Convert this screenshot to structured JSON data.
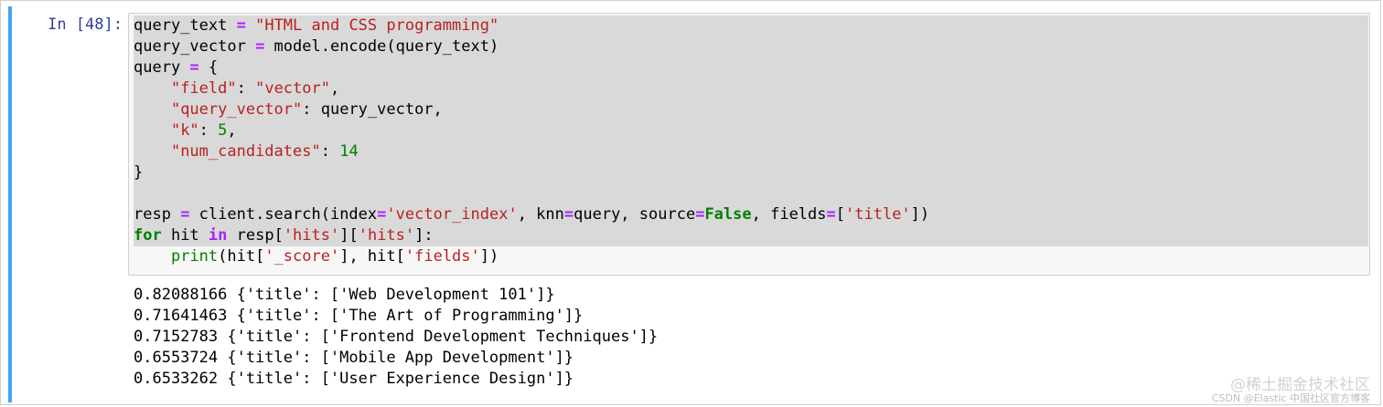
{
  "cell": {
    "prompt": "In [48]:",
    "accent_color": "#42A5F5"
  },
  "code": {
    "l1": {
      "a": "query_text ",
      "b": "=",
      "c": " ",
      "d": "\"HTML and CSS programming\""
    },
    "l2": {
      "a": "query_vector ",
      "b": "=",
      "c": " model.encode(query_text)"
    },
    "l3": {
      "a": "query ",
      "b": "=",
      "c": " {"
    },
    "l4": {
      "a": "    ",
      "b": "\"field\"",
      "c": ": ",
      "d": "\"vector\"",
      "e": ","
    },
    "l5": {
      "a": "    ",
      "b": "\"query_vector\"",
      "c": ": query_vector,"
    },
    "l6": {
      "a": "    ",
      "b": "\"k\"",
      "c": ": ",
      "d": "5",
      "e": ","
    },
    "l7": {
      "a": "    ",
      "b": "\"num_candidates\"",
      "c": ": ",
      "d": "14"
    },
    "l8": {
      "a": "}"
    },
    "l10": {
      "a": "resp ",
      "b": "=",
      "c": " client.search(index",
      "d": "=",
      "e": "'vector_index'",
      "f": ", knn",
      "g": "=",
      "h": "query, source",
      "i": "=",
      "j": "False",
      "k": ", fields",
      "l": "=",
      "m": "[",
      "n": "'title'",
      "o": "])"
    },
    "l11": {
      "a": "for",
      "b": " hit ",
      "c": "in",
      "d": " resp[",
      "e": "'hits'",
      "f": "][",
      "g": "'hits'",
      "h": "]:"
    },
    "l12": {
      "a": "    ",
      "b": "print",
      "c": "(hit[",
      "d": "'_score'",
      "e": "], hit[",
      "f": "'fields'",
      "g": "])"
    }
  },
  "output": {
    "lines": [
      "0.82088166 {'title': ['Web Development 101']}",
      "0.71641463 {'title': ['The Art of Programming']}",
      "0.7152783 {'title': ['Frontend Development Techniques']}",
      "0.6553724 {'title': ['Mobile App Development']}",
      "0.6533262 {'title': ['User Experience Design']}"
    ]
  },
  "watermark": {
    "main": "@稀土掘金技术社区",
    "sub": "CSDN @Elastic 中国社区官方博客"
  }
}
